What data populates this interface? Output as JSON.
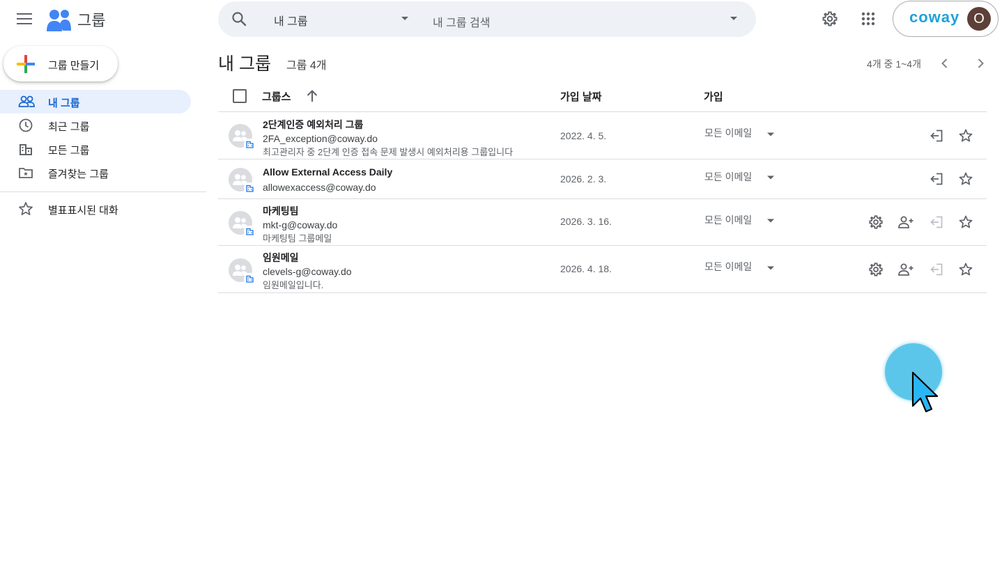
{
  "header": {
    "app_title": "그룹",
    "search": {
      "scope": "내 그룹",
      "placeholder": "내 그룹 검색"
    },
    "account": {
      "brand": "coway",
      "avatar_letter": "O",
      "brand_color": "#1fa2d8",
      "avatar_color": "#5d4037"
    }
  },
  "sidebar": {
    "create_button": "그룹 만들기",
    "items": [
      {
        "label": "내 그룹",
        "icon": "people-icon",
        "active": true
      },
      {
        "label": "최근 그룹",
        "icon": "clock-icon",
        "active": false
      },
      {
        "label": "모든 그룹",
        "icon": "building-icon",
        "active": false
      },
      {
        "label": "즐겨찾는 그룹",
        "icon": "folder-star-icon",
        "active": false
      }
    ],
    "starred": {
      "label": "별표표시된 대화",
      "icon": "star-outline-icon"
    }
  },
  "main": {
    "title": "내 그룹",
    "count": "그룹 4개",
    "pager": "4개 중 1~4개",
    "columns": {
      "groups": "그룹스",
      "joined_date": "가입 날짜",
      "subscription": "가입"
    },
    "groups": [
      {
        "name": "2단계인증 예외처리 그룹",
        "email": "2FA_exception@coway.do",
        "description": "최고관리자 중 2단계 인증 접속 문제 발생시 예외처리용 그룹입니다",
        "date": "2022. 4. 5.",
        "subscription": "모든 이메일",
        "actions": [
          "leave",
          "star"
        ]
      },
      {
        "name": "Allow External Access Daily",
        "email": "allowexaccess@coway.do",
        "description": "",
        "date": "2026. 2. 3.",
        "subscription": "모든 이메일",
        "actions": [
          "leave",
          "star"
        ]
      },
      {
        "name": "마케팅팀",
        "email": "mkt-g@coway.do",
        "description": "마케팅팀 그룹메일",
        "date": "2026. 3. 16.",
        "subscription": "모든 이메일",
        "actions": [
          "settings",
          "add-member",
          "leave-disabled",
          "star"
        ]
      },
      {
        "name": "임원메일",
        "email": "clevels-g@coway.do",
        "description": "임원메일입니다.",
        "date": "2026. 4. 18.",
        "subscription": "모든 이메일",
        "actions": [
          "settings",
          "add-member",
          "leave-disabled",
          "star"
        ]
      }
    ]
  },
  "colors": {
    "accent": "#1967d2",
    "active_nav_bg": "#e8f0fe",
    "search_bg": "#eef1f6",
    "cursor_halo": "#5cc6ea"
  }
}
